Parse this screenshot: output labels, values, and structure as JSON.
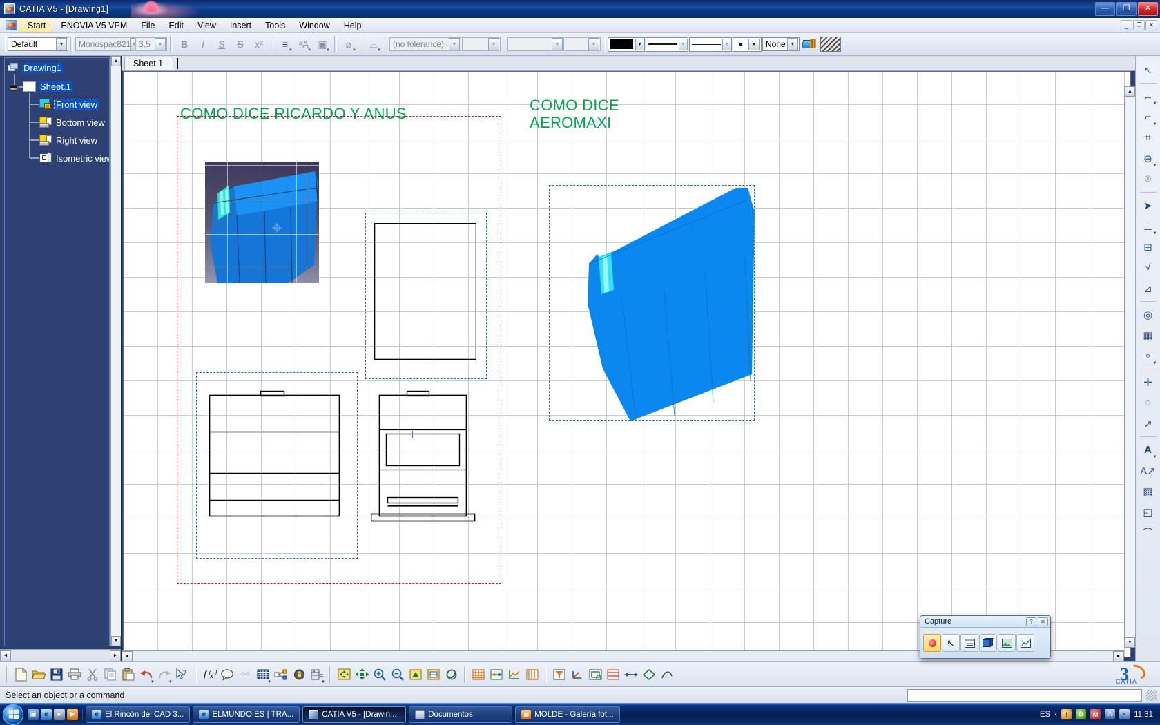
{
  "window": {
    "title": "CATIA V5 - [Drawing1]",
    "app_icon": "catia-icon",
    "minimize": "—",
    "maximize": "❐",
    "close": "✕"
  },
  "menubar": {
    "items": [
      {
        "label": "Start",
        "highlighted": true
      },
      {
        "label": "ENOVIA V5 VPM",
        "highlighted": false
      },
      {
        "label": "File",
        "highlighted": false
      },
      {
        "label": "Edit",
        "highlighted": false
      },
      {
        "label": "View",
        "highlighted": false
      },
      {
        "label": "Insert",
        "highlighted": false
      },
      {
        "label": "Tools",
        "highlighted": false
      },
      {
        "label": "Window",
        "highlighted": false
      },
      {
        "label": "Help",
        "highlighted": false
      }
    ],
    "mdi": {
      "minimize": "_",
      "restore": "❐",
      "close": "✕"
    }
  },
  "toolbar": {
    "style_combo": "Default",
    "font_combo": "Monospac821",
    "size_combo": "3,5",
    "bold": "B",
    "italic": "I",
    "underline": "S",
    "strike": "S",
    "superscript": "x²",
    "align": "≡",
    "anchor_a": "A",
    "frame_a": "A",
    "tolerance_combo": "(no tolerance)",
    "tolerance_value": "",
    "dim_combo_1": "",
    "dim_combo_2": "",
    "color_swatch": "#000000",
    "line_weight": "line",
    "line_type": "line",
    "point_style": "•",
    "pattern_combo": "None"
  },
  "tree": {
    "nodes": [
      {
        "label": "Drawing1",
        "icon": "drawing-icon",
        "selected": true,
        "indent": 0
      },
      {
        "label": "Sheet.1",
        "icon": "sheet-icon",
        "selected": true,
        "indent": 1
      },
      {
        "label": "Front view",
        "icon": "front-view-icon",
        "selected": true,
        "indent": 2
      },
      {
        "label": "Bottom view",
        "icon": "bottom-view-icon",
        "selected": false,
        "indent": 2
      },
      {
        "label": "Right view",
        "icon": "right-view-icon",
        "selected": false,
        "indent": 2
      },
      {
        "label": "Isometric view",
        "icon": "isometric-view-icon",
        "selected": false,
        "indent": 2
      }
    ],
    "scroll_up": "▲",
    "scroll_down": "▼",
    "scroll_left": "◄",
    "scroll_right": "►"
  },
  "drawing": {
    "tab_label": "Sheet.1",
    "annotations": [
      {
        "text": "COMO DICE RICARDO Y ANUS",
        "color": "#00a550"
      },
      {
        "text": "COMO DICE\nAEROMAXI",
        "color": "#00a550"
      }
    ],
    "view_labels": [
      "",
      "",
      "",
      ""
    ],
    "frame_color_red": "#b22222",
    "frame_color_blue": "#2a6ebb",
    "scroll_up": "▲",
    "scroll_down": "▼",
    "scroll_left": "◄",
    "scroll_right": "►"
  },
  "statusbar": {
    "message": "Select an object or a command",
    "field_value": ""
  },
  "capture_dialog": {
    "title": "Capture",
    "help_btn": "?",
    "close_btn": "✕",
    "tools": [
      {
        "name": "capture-record-button",
        "glyph": "●",
        "selected": true
      },
      {
        "name": "capture-select-button",
        "glyph": "↖",
        "selected": false
      },
      {
        "name": "capture-window-button",
        "glyph": "▤",
        "selected": false
      },
      {
        "name": "capture-album-button",
        "glyph": "📚",
        "selected": false
      },
      {
        "name": "capture-image-button",
        "glyph": "🖼",
        "selected": false
      },
      {
        "name": "capture-print-button",
        "glyph": "📈",
        "selected": false
      }
    ]
  },
  "bottom_toolbar": {
    "buttons": [
      {
        "name": "new-button",
        "glyph": "🗋"
      },
      {
        "name": "open-button",
        "glyph": "📂"
      },
      {
        "name": "save-button",
        "glyph": "💾"
      },
      {
        "name": "print-button",
        "glyph": "🖨"
      },
      {
        "name": "cut-button",
        "glyph": "✂"
      },
      {
        "name": "copy-button",
        "glyph": "⧉"
      },
      {
        "name": "paste-button",
        "glyph": "📋"
      },
      {
        "name": "undo-button",
        "glyph": "↩"
      },
      {
        "name": "redo-button",
        "glyph": "↪"
      },
      {
        "name": "whats-this-button",
        "glyph": "↖?"
      },
      {
        "name": "formula-button",
        "glyph": "ƒ"
      },
      {
        "name": "comment-button",
        "glyph": "💬"
      },
      {
        "name": "link-button",
        "glyph": "🔗"
      },
      {
        "name": "table-button",
        "glyph": "▦"
      },
      {
        "name": "relations-button",
        "glyph": "⛓"
      },
      {
        "name": "lock-button",
        "glyph": "🔒"
      },
      {
        "name": "catalog-button",
        "glyph": "🗄"
      },
      {
        "name": "fit-all-button",
        "glyph": "⤢"
      },
      {
        "name": "pan-button",
        "glyph": "✥"
      },
      {
        "name": "zoom-in-button",
        "glyph": "🔍"
      },
      {
        "name": "zoom-out-button",
        "glyph": "🔎"
      },
      {
        "name": "normal-view-button",
        "glyph": "▣"
      },
      {
        "name": "view-mode-button",
        "glyph": "▨"
      },
      {
        "name": "render-style-button",
        "glyph": "◍"
      },
      {
        "name": "grid-button",
        "glyph": "▦"
      },
      {
        "name": "snap-button",
        "glyph": "⊞"
      },
      {
        "name": "dim-button",
        "glyph": "↔"
      },
      {
        "name": "analysis-button",
        "glyph": "📐"
      },
      {
        "name": "layer-button",
        "glyph": "▥"
      },
      {
        "name": "filter-button",
        "glyph": "⊟"
      },
      {
        "name": "axis-button",
        "glyph": "⌖"
      },
      {
        "name": "section-button",
        "glyph": "▩"
      },
      {
        "name": "detail-button",
        "glyph": "◲"
      },
      {
        "name": "annotation-button",
        "glyph": "◇"
      }
    ]
  },
  "rail": {
    "buttons": [
      {
        "name": "select-arrow-icon",
        "glyph": "↖"
      },
      {
        "name": "dimension-icon",
        "glyph": "↔"
      },
      {
        "name": "chamfer-dim-icon",
        "glyph": "⌐"
      },
      {
        "name": "thread-dim-icon",
        "glyph": "⌗"
      },
      {
        "name": "hole-dim-icon",
        "glyph": "⊕"
      },
      {
        "name": "coordinate-dim-icon",
        "glyph": "⌾"
      },
      {
        "name": "pointer-icon",
        "glyph": "➤"
      },
      {
        "name": "datum-icon",
        "glyph": "⊥"
      },
      {
        "name": "tolerance-icon",
        "glyph": "⊞"
      },
      {
        "name": "roughness-icon",
        "glyph": "√"
      },
      {
        "name": "weld-icon",
        "glyph": "⊿"
      },
      {
        "name": "balloon-icon",
        "glyph": "◎"
      },
      {
        "name": "table-icon",
        "glyph": "▦"
      },
      {
        "name": "axis-line-icon",
        "glyph": "⌖"
      },
      {
        "name": "center-line-icon",
        "glyph": "✛"
      },
      {
        "name": "thread-icon",
        "glyph": "◌"
      },
      {
        "name": "arrow-icon",
        "glyph": "↗"
      },
      {
        "name": "text-icon",
        "glyph": "A"
      },
      {
        "name": "leader-text-icon",
        "glyph": "A↗"
      },
      {
        "name": "hatch-icon",
        "glyph": "▨"
      },
      {
        "name": "geometry-icon",
        "glyph": "◰"
      },
      {
        "name": "profile-icon",
        "glyph": "⌒"
      }
    ]
  },
  "taskbar": {
    "start": "start-orb",
    "quick_launch": [
      {
        "name": "show-desktop-icon",
        "glyph": "▣"
      },
      {
        "name": "internet-explorer-icon",
        "glyph": "e"
      },
      {
        "name": "media-player-icon",
        "glyph": "▸"
      },
      {
        "name": "windows-media-icon",
        "glyph": "▶"
      }
    ],
    "buttons": [
      {
        "label": "El Rincón del CAD 3...",
        "icon": "ie-icon",
        "active": false
      },
      {
        "label": "ELMUNDO.ES | TRA...",
        "icon": "ie-icon",
        "active": false
      },
      {
        "label": "CATIA V5 - [Drawin...",
        "icon": "catia-icon",
        "active": true
      },
      {
        "label": "Documentos",
        "icon": "folder-icon",
        "active": false
      },
      {
        "label": "MOLDE - Galería fot...",
        "icon": "gallery-icon",
        "active": false
      }
    ],
    "tray": {
      "language": "ES",
      "chevron": "‹",
      "icons": [
        {
          "name": "warning-icon",
          "glyph": "!"
        },
        {
          "name": "antivirus-icon",
          "glyph": "✿"
        },
        {
          "name": "app-icon",
          "glyph": "M"
        },
        {
          "name": "network-icon",
          "glyph": "🖧"
        },
        {
          "name": "volume-icon",
          "glyph": "🔊"
        }
      ],
      "clock": "11:31"
    }
  }
}
